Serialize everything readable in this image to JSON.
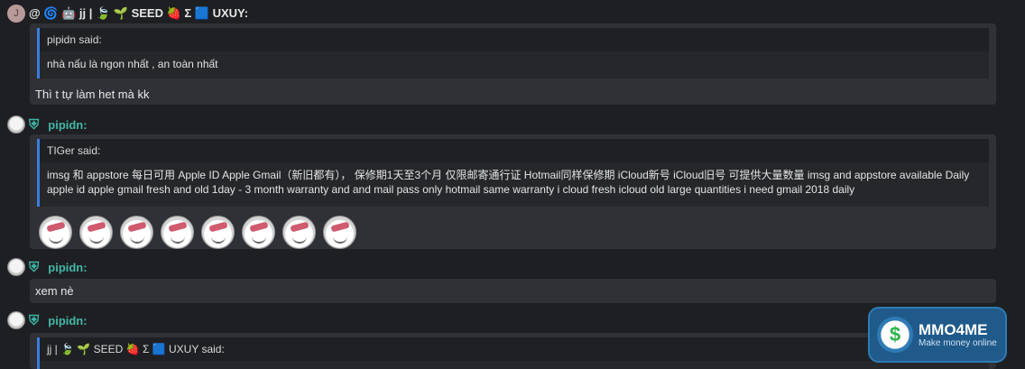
{
  "post1": {
    "avatar_letter": "J",
    "header": "@ 🌀 🤖 jj | 🍃 🌱 SEED 🍓 Σ 🟦 UXUY:",
    "quote_author": "pipidn said:",
    "quote_text": "nhà nấu là ngon nhất , an toàn nhất",
    "message": "Thì t tự làm het mà kk"
  },
  "post2": {
    "username": "pipidn:",
    "quote_author": "TIGer said:",
    "quote_text": "imsg 和 appstore 每日可用 Apple ID Apple Gmail（新旧都有）， 保修期1天至3个月 仅限邮寄通行证 Hotmail同样保修期 iCloud新号 iCloud旧号 可提供大量数量 imsg and appstore available Daily apple id apple gmail fresh and old 1day - 3 month warranty and and mail pass only hotmail same warranty i cloud fresh icloud old large quantities i need gmail 2018 daily",
    "sticker_count": 8
  },
  "post3": {
    "username": "pipidn:",
    "message": "xem nè"
  },
  "post4": {
    "username": "pipidn:",
    "quote_author": "jj | 🍃 🌱 SEED 🍓 Σ 🟦 UXUY said:"
  },
  "logo": {
    "title": "MMO4ME",
    "subtitle": "Make money online",
    "symbol": "$"
  },
  "colors": {
    "background": "#1e1f22",
    "bubble": "#2f3136",
    "quote_border": "#3b7ddd",
    "username": "#42b7a6"
  }
}
